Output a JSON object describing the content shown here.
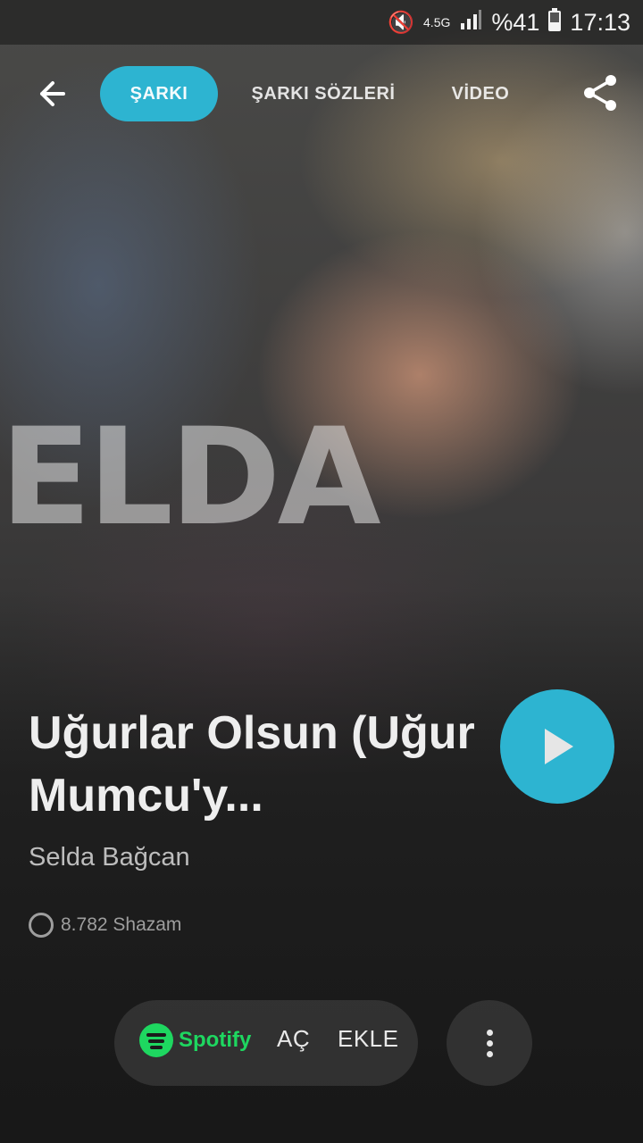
{
  "status_bar": {
    "network": "4.5G",
    "battery": "%41",
    "time": "17:13",
    "icons": [
      "mute-icon",
      "signal-icon",
      "battery-icon"
    ]
  },
  "artwork": {
    "lettering": "ELDA"
  },
  "nav": {
    "back_icon": "back-arrow-icon",
    "tabs": [
      {
        "label": "ŞARKI",
        "active": true
      },
      {
        "label": "ŞARKI SÖZLERİ",
        "active": false
      },
      {
        "label": "VİDEO",
        "active": false
      }
    ],
    "share_icon": "share-icon"
  },
  "song": {
    "title": "Uğurlar Olsun (Uğur Mumcu'y...",
    "artist": "Selda Bağcan",
    "shazam_count": "8.782 Shazam"
  },
  "actions": {
    "provider": "Spotify",
    "open_label": "AÇ",
    "add_label": "EKLE",
    "more_icon": "more-vertical-icon"
  },
  "colors": {
    "accent": "#2db4d1",
    "spotify_green": "#1ed760"
  }
}
